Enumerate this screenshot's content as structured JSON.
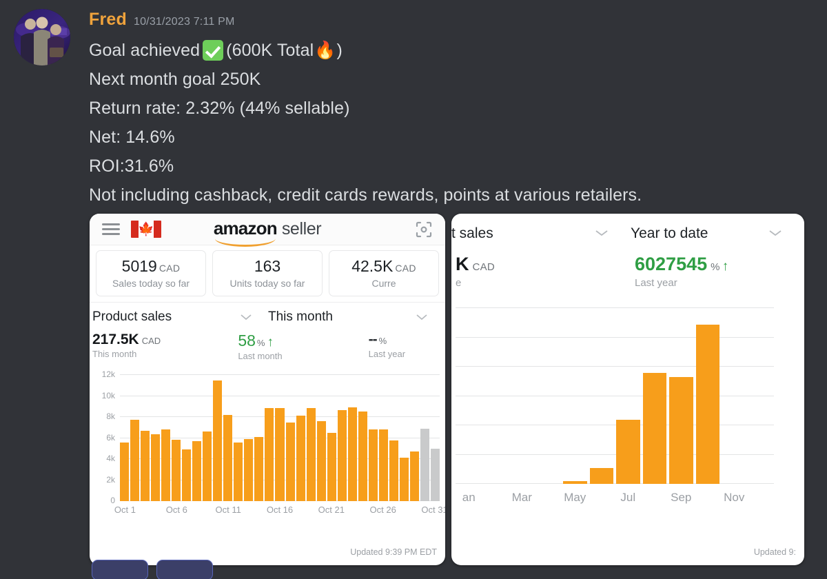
{
  "message": {
    "author": "Fred",
    "author_color": "#f0a33c",
    "timestamp": "10/31/2023 7:11 PM",
    "lines": [
      "Goal achieved",
      "(600K Total",
      ")",
      "Next month goal 250K",
      "Return rate: 2.32% (44% sellable)",
      "Net: 14.6%",
      "ROI:31.6%",
      "Not including cashback, credit cards rewards, points at various retailers."
    ],
    "line1_prefix": "Goal achieved",
    "line1_mid": "(600K Total",
    "line1_suffix": ")",
    "line2": "Next month goal 250K",
    "line3": "Return rate: 2.32% (44% sellable)",
    "line4": "Net: 14.6%",
    "line5": "ROI:31.6%",
    "line6": "Not including cashback, credit cards rewards, points at various retailers.",
    "check_emoji": "white-check-mark-emoji",
    "fire_emoji": "🔥"
  },
  "left_app": {
    "menu_icon": "hamburger-menu-icon",
    "flag": "canada-flag-icon",
    "leaf": "🍁",
    "brand_word": "amazon",
    "brand_suffix": "seller",
    "scan_icon": "scan-viewfinder-icon",
    "metrics": [
      {
        "value": "5019",
        "currency": "CAD",
        "label": "Sales today so far"
      },
      {
        "value": "163",
        "currency": "",
        "label": "Units today so far"
      },
      {
        "value": "42.5K",
        "currency": "CAD",
        "label": "Curre"
      }
    ],
    "selector_metric": "Product sales",
    "selector_period": "This month",
    "kpis": [
      {
        "value": "217.5K",
        "unit": "CAD",
        "sub": "This month"
      },
      {
        "value": "58",
        "unit": "%",
        "sub": "Last month",
        "arrow": "↑"
      },
      {
        "value": "--",
        "unit": "%",
        "sub": "Last year",
        "arrow": ""
      }
    ],
    "updated": "Updated 9:39 PM EDT"
  },
  "right_app": {
    "selector_metric": "t sales",
    "selector_period": "Year to date",
    "kpi_left_value": "K",
    "kpi_left_unit": "CAD",
    "kpi_left_sub": "e",
    "kpi_right_value": "6027545",
    "kpi_right_unit": "%",
    "kpi_right_arrow": "↑",
    "kpi_right_sub": "Last year",
    "updated": "Updated 9:"
  },
  "chart_data": [
    {
      "type": "bar",
      "title": "Product sales — This month",
      "xlabel": "",
      "ylabel": "",
      "ylim": [
        0,
        12000
      ],
      "yticks": [
        0,
        2000,
        4000,
        6000,
        8000,
        10000,
        12000
      ],
      "ytick_labels": [
        "0",
        "2k",
        "4k",
        "6k",
        "8k",
        "10k",
        "12k"
      ],
      "xtick_labels": [
        "Oct 1",
        "Oct 6",
        "Oct 11",
        "Oct 16",
        "Oct 21",
        "Oct 26",
        "Oct 31"
      ],
      "xtick_indices": [
        0,
        5,
        10,
        15,
        20,
        25,
        30
      ],
      "grid": true,
      "bar_color": "#f79e1b",
      "projected_color": "#c9cacb",
      "categories": [
        "Oct 1",
        "Oct 2",
        "Oct 3",
        "Oct 4",
        "Oct 5",
        "Oct 6",
        "Oct 7",
        "Oct 8",
        "Oct 9",
        "Oct 10",
        "Oct 11",
        "Oct 12",
        "Oct 13",
        "Oct 14",
        "Oct 15",
        "Oct 16",
        "Oct 17",
        "Oct 18",
        "Oct 19",
        "Oct 20",
        "Oct 21",
        "Oct 22",
        "Oct 23",
        "Oct 24",
        "Oct 25",
        "Oct 26",
        "Oct 27",
        "Oct 28",
        "Oct 29",
        "Oct 30",
        "Oct 31"
      ],
      "values": [
        5600,
        7750,
        6700,
        6350,
        6850,
        5850,
        4900,
        5700,
        6600,
        11450,
        8200,
        5550,
        5900,
        6100,
        8850,
        8850,
        7450,
        8150,
        8850,
        7600,
        6500,
        8650,
        8950,
        8500,
        6800,
        6850,
        5750,
        4150,
        4750,
        6900,
        5000
      ],
      "projected_from_index": 29
    },
    {
      "type": "bar",
      "title": "Net sales — Year to date",
      "xlabel": "",
      "ylabel": "",
      "ylim": [
        0,
        240000
      ],
      "grid": true,
      "bar_color": "#f79e1b",
      "xtick_labels": [
        "an",
        "Mar",
        "May",
        "Jul",
        "Sep",
        "Nov"
      ],
      "xtick_indices": [
        0,
        2,
        4,
        6,
        8,
        10
      ],
      "categories": [
        "Jan",
        "Feb",
        "Mar",
        "Apr",
        "May",
        "Jun",
        "Jul",
        "Aug",
        "Sep",
        "Oct",
        "Nov",
        "Dec"
      ],
      "values": [
        0,
        0,
        0,
        0,
        4000,
        22000,
        88000,
        152000,
        146000,
        217500,
        0,
        0
      ]
    }
  ],
  "reactions": [
    {
      "name": "reaction-pill-1"
    },
    {
      "name": "reaction-pill-2"
    }
  ]
}
